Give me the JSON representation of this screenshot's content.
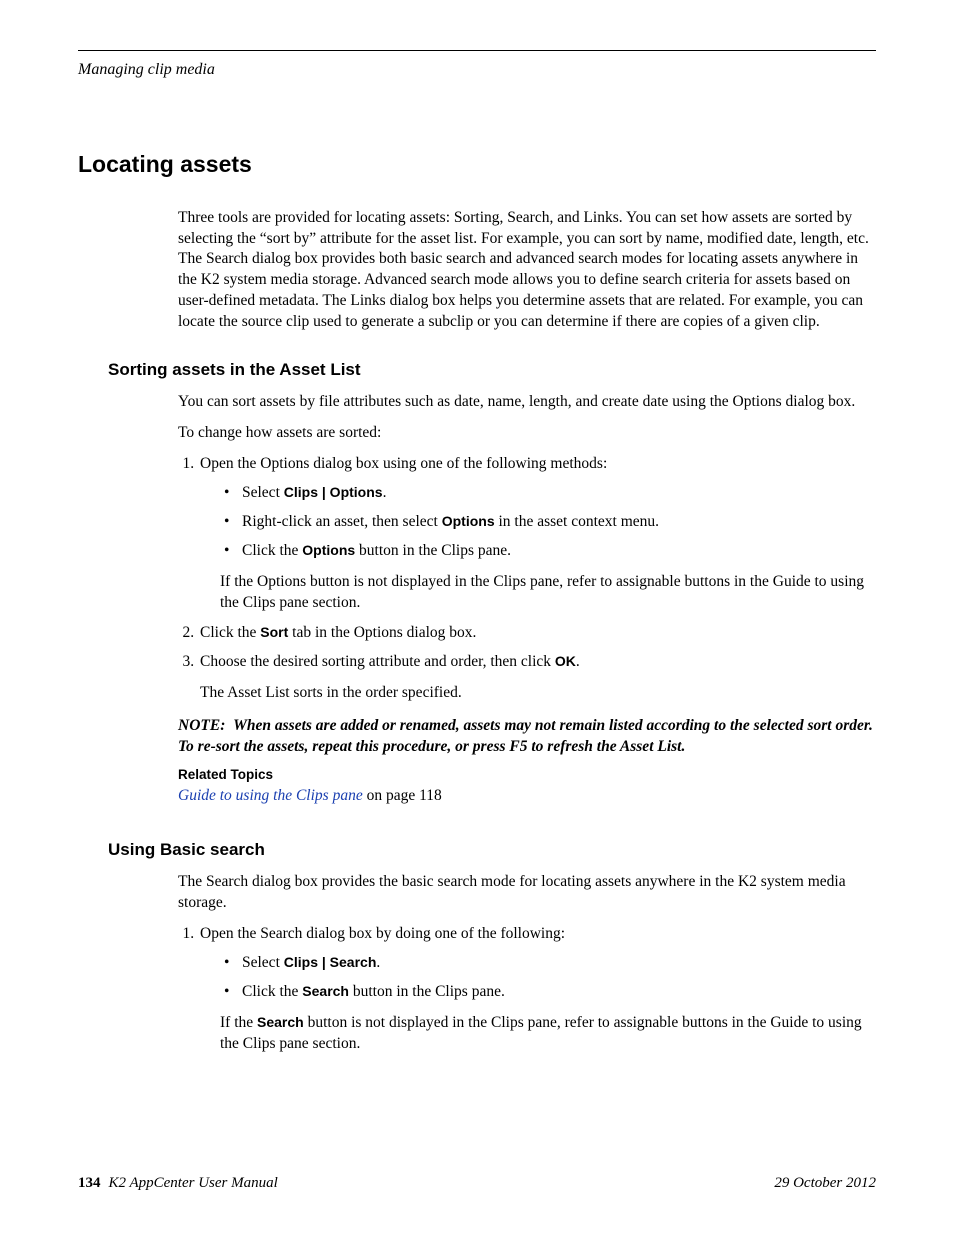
{
  "header": {
    "running_head": "Managing clip media"
  },
  "section": {
    "title": "Locating assets",
    "intro": "Three tools are provided for locating assets: Sorting, Search, and Links. You can set how assets are sorted by selecting the “sort by” attribute for the asset list. For example, you can sort by name, modified date, length, etc. The Search dialog box provides both basic search and advanced search modes for locating assets anywhere in the K2 system media storage. Advanced search mode allows you to define search criteria for assets based on user-defined metadata. The Links dialog box helps you determine assets that are related. For example, you can locate the source clip used to generate a subclip or you can determine if there are copies of a given clip."
  },
  "sorting": {
    "heading": "Sorting assets in the Asset List",
    "p1": "You can sort assets by file attributes such as date, name, length, and create date using the Options dialog box.",
    "p2": "To change how assets are sorted:",
    "step1_intro": "Open the Options dialog box using one of the following methods:",
    "step1_b1_pre": "Select ",
    "step1_b1_bold": "Clips | Options",
    "step1_b1_post": ".",
    "step1_b2_pre": "Right-click an asset, then select ",
    "step1_b2_bold": "Options",
    "step1_b2_post": " in the asset context menu.",
    "step1_b3_pre": "Click the ",
    "step1_b3_bold": "Options",
    "step1_b3_post": " button in the Clips pane.",
    "step1_follow": "If the Options button is not displayed in the Clips pane, refer to assignable buttons in the Guide to using the Clips pane section.",
    "step2_pre": "Click the ",
    "step2_bold": "Sort",
    "step2_post": " tab in the Options dialog box.",
    "step3_pre": "Choose the desired sorting attribute and order, then click ",
    "step3_bold": "OK",
    "step3_post": ".",
    "step3_follow": "The Asset List sorts in the order specified.",
    "note": "NOTE:  When assets are added or renamed, assets may not remain listed according to the selected sort order. To re-sort the assets, repeat this procedure, or press F5 to refresh the Asset List.",
    "related_heading": "Related Topics",
    "related_link": "Guide to using the Clips pane",
    "related_suffix": " on page 118"
  },
  "basic_search": {
    "heading": "Using Basic search",
    "p1": "The Search dialog box provides the basic search mode for locating assets anywhere in the K2 system media storage.",
    "step1_intro": "Open the Search dialog box by doing one of the following:",
    "step1_b1_pre": "Select ",
    "step1_b1_bold": "Clips | Search",
    "step1_b1_post": ".",
    "step1_b2_pre": "Click the ",
    "step1_b2_bold": "Search",
    "step1_b2_post": " button in the Clips pane.",
    "step1_follow_pre": "If the ",
    "step1_follow_bold": "Search",
    "step1_follow_post": " button is not displayed in the Clips pane, refer to assignable buttons in the Guide to using the Clips pane section."
  },
  "footer": {
    "page_number": "134",
    "title": "K2 AppCenter User Manual",
    "date": "29 October 2012"
  }
}
